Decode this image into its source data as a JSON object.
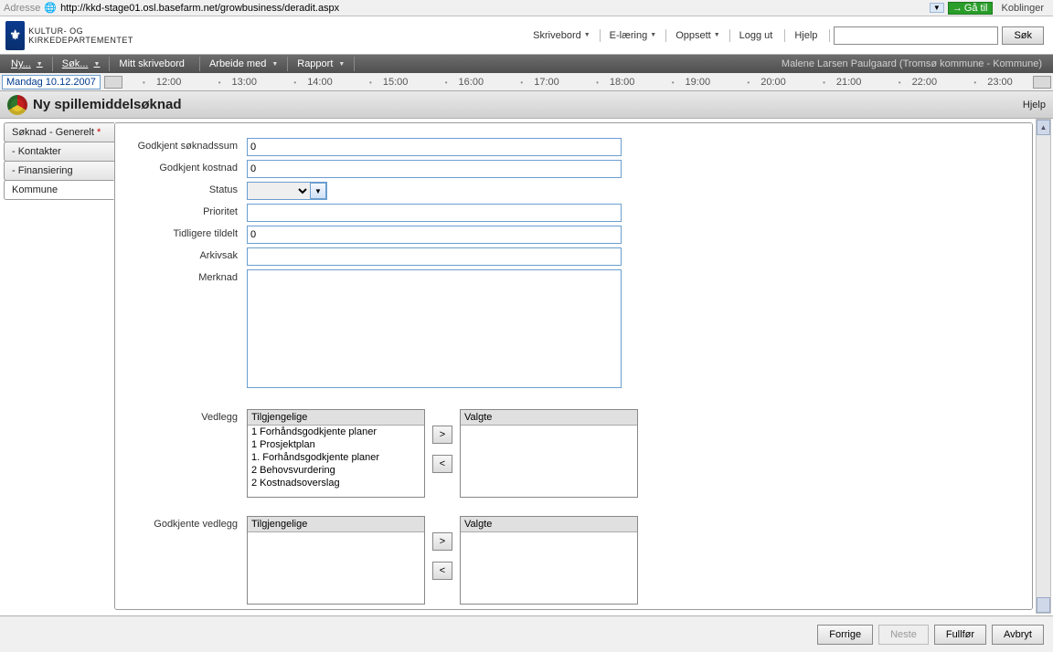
{
  "browser": {
    "addr_label": "Adresse",
    "url": "http://kkd-stage01.osl.basefarm.net/growbusiness/deradit.aspx",
    "gatil": "Gå til",
    "koblinger": "Koblinger"
  },
  "header": {
    "dept": "Kultur- og Kirkedepartementet",
    "menu": {
      "skrivebord": "Skrivebord",
      "elaering": "E-læring",
      "oppsett": "Oppsett",
      "loggut": "Logg ut",
      "hjelp": "Hjelp"
    },
    "search_placeholder": "",
    "search_btn": "Søk"
  },
  "toolbar": {
    "ny": "Ny...",
    "sok": "Søk...",
    "mittskrivebord": "Mitt skrivebord",
    "arbeidemed": "Arbeide med",
    "rapport": "Rapport",
    "user": "Malene Larsen Paulgaard (Tromsø kommune - Kommune)"
  },
  "timeline": {
    "date": "Mandag 10.12.2007",
    "hours": [
      "12:00",
      "13:00",
      "14:00",
      "15:00",
      "16:00",
      "17:00",
      "18:00",
      "19:00",
      "20:00",
      "21:00",
      "22:00",
      "23:00"
    ]
  },
  "page": {
    "title": "Ny spillemiddelsøknad",
    "help": "Hjelp"
  },
  "sidebar": {
    "tabs": [
      {
        "label": "Søknad - Generelt",
        "required": true
      },
      {
        "label": "- Kontakter",
        "required": false
      },
      {
        "label": "- Finansiering",
        "required": false
      },
      {
        "label": "Kommune",
        "required": false
      }
    ]
  },
  "form": {
    "godkjent_soknadssum_label": "Godkjent søknadssum",
    "godkjent_soknadssum_value": "0",
    "godkjent_kostnad_label": "Godkjent kostnad",
    "godkjent_kostnad_value": "0",
    "status_label": "Status",
    "status_value": "",
    "prioritet_label": "Prioritet",
    "prioritet_value": "",
    "tidligere_tildelt_label": "Tidligere tildelt",
    "tidligere_tildelt_value": "0",
    "arkivsak_label": "Arkivsak",
    "arkivsak_value": "",
    "merknad_label": "Merknad",
    "merknad_value": ""
  },
  "vedlegg": {
    "label": "Vedlegg",
    "available_header": "Tilgjengelige",
    "selected_header": "Valgte",
    "available": [
      "1 Forhåndsgodkjente planer",
      "1 Prosjektplan",
      "1. Forhåndsgodkjente planer",
      "2 Behovsvurdering",
      "2 Kostnadsoverslag"
    ],
    "move_right": ">",
    "move_left": "<"
  },
  "godkjente_vedlegg": {
    "label": "Godkjente vedlegg",
    "available_header": "Tilgjengelige",
    "selected_header": "Valgte",
    "move_right": ">",
    "move_left": "<"
  },
  "footer": {
    "forrige": "Forrige",
    "neste": "Neste",
    "fullfor": "Fullfør",
    "avbryt": "Avbryt"
  }
}
